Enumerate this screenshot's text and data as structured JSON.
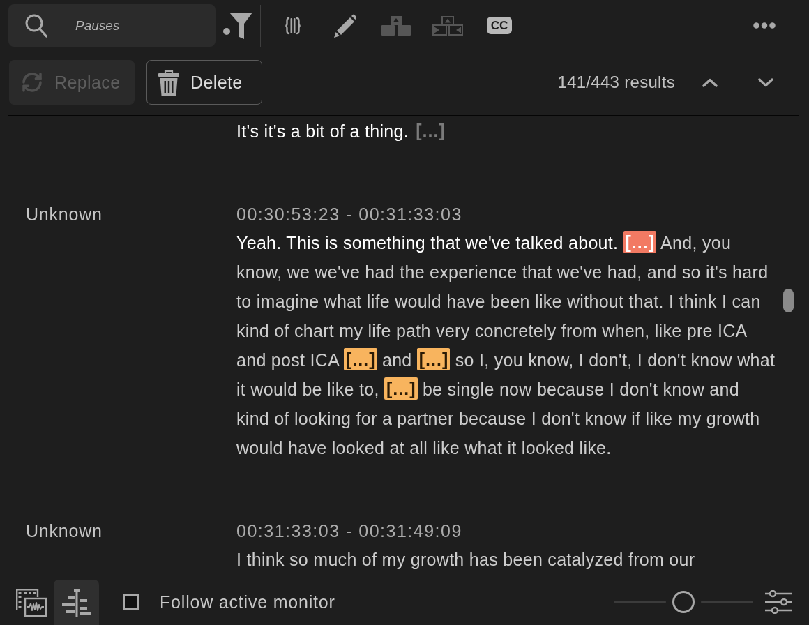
{
  "search": {
    "value": "Pauses"
  },
  "tool_groups": [
    [
      {
        "kind": "filter",
        "disabled": false
      }
    ],
    [
      {
        "kind": "braces",
        "disabled": false
      },
      {
        "kind": "pencil",
        "disabled": false
      },
      {
        "kind": "blocks",
        "disabled": true
      },
      {
        "kind": "blocks_arrows",
        "disabled": true
      },
      {
        "kind": "captions",
        "label": "CC",
        "disabled": false
      }
    ]
  ],
  "actions": [
    {
      "kind": "replace",
      "label": "Replace",
      "disabled": true
    },
    {
      "kind": "delete",
      "label": "Delete",
      "disabled": false
    }
  ],
  "results": {
    "count": "141/443 results"
  },
  "segments": [
    {
      "lines": [
        {
          "runs": [
            {
              "kind": "words",
              "text": "It's it's a bit of a thing.",
              "played": true
            },
            {
              "kind": "pause",
              "label": "[…]",
              "matched": false,
              "current": false
            }
          ]
        }
      ]
    },
    {
      "speaker": "Unknown",
      "timecode": "00:30:53:23 - 00:31:33:03",
      "lines": [
        {
          "runs": [
            {
              "kind": "words",
              "text": "Yeah. This is something that we've talked about.",
              "played": true
            },
            {
              "kind": "pause",
              "label": "[…]",
              "matched": true,
              "current": true
            },
            {
              "kind": "words",
              "text": "And, you",
              "played": false
            }
          ]
        },
        {
          "runs": [
            {
              "kind": "words",
              "text": "know, we we've had the experience that we've had, and so it's hard",
              "played": false
            }
          ]
        },
        {
          "runs": [
            {
              "kind": "words",
              "text": "to imagine what life would have been like without that. I think I can",
              "played": false
            }
          ]
        },
        {
          "runs": [
            {
              "kind": "words",
              "text": "kind of chart my life path very concretely from when, like pre ICA",
              "played": false
            }
          ]
        },
        {
          "runs": [
            {
              "kind": "words",
              "text": "and post ICA",
              "played": false
            },
            {
              "kind": "pause",
              "label": "[…]",
              "matched": true,
              "current": false
            },
            {
              "kind": "words",
              "text": "and",
              "played": false
            },
            {
              "kind": "pause",
              "label": "[…]",
              "matched": true,
              "current": false
            },
            {
              "kind": "words",
              "text": "so I, you know, I don't, I don't know what",
              "played": false
            }
          ]
        },
        {
          "runs": [
            {
              "kind": "words",
              "text": "it would be like to,",
              "played": false
            },
            {
              "kind": "pause",
              "label": "[…]",
              "matched": true,
              "current": false
            },
            {
              "kind": "words",
              "text": "be single now because I don't know and",
              "played": false
            }
          ]
        },
        {
          "runs": [
            {
              "kind": "words",
              "text": "kind of looking for a partner because I don't know if like my growth",
              "played": false
            }
          ]
        },
        {
          "runs": [
            {
              "kind": "words",
              "text": "would have looked at all like what it looked like.",
              "played": false
            }
          ]
        }
      ]
    },
    {
      "speaker": "Unknown",
      "timecode": "00:31:33:03 - 00:31:49:09",
      "lines": [
        {
          "runs": [
            {
              "kind": "words",
              "text": "I think so much of my growth has been catalyzed from our",
              "played": false
            }
          ]
        }
      ]
    }
  ],
  "footer": {
    "views": [
      {
        "kind": "media",
        "selected": false
      },
      {
        "kind": "transcript",
        "selected": true
      }
    ],
    "follow": {
      "label": "Follow active monitor",
      "checked": false
    },
    "zoom": {
      "level": 0.5
    }
  }
}
